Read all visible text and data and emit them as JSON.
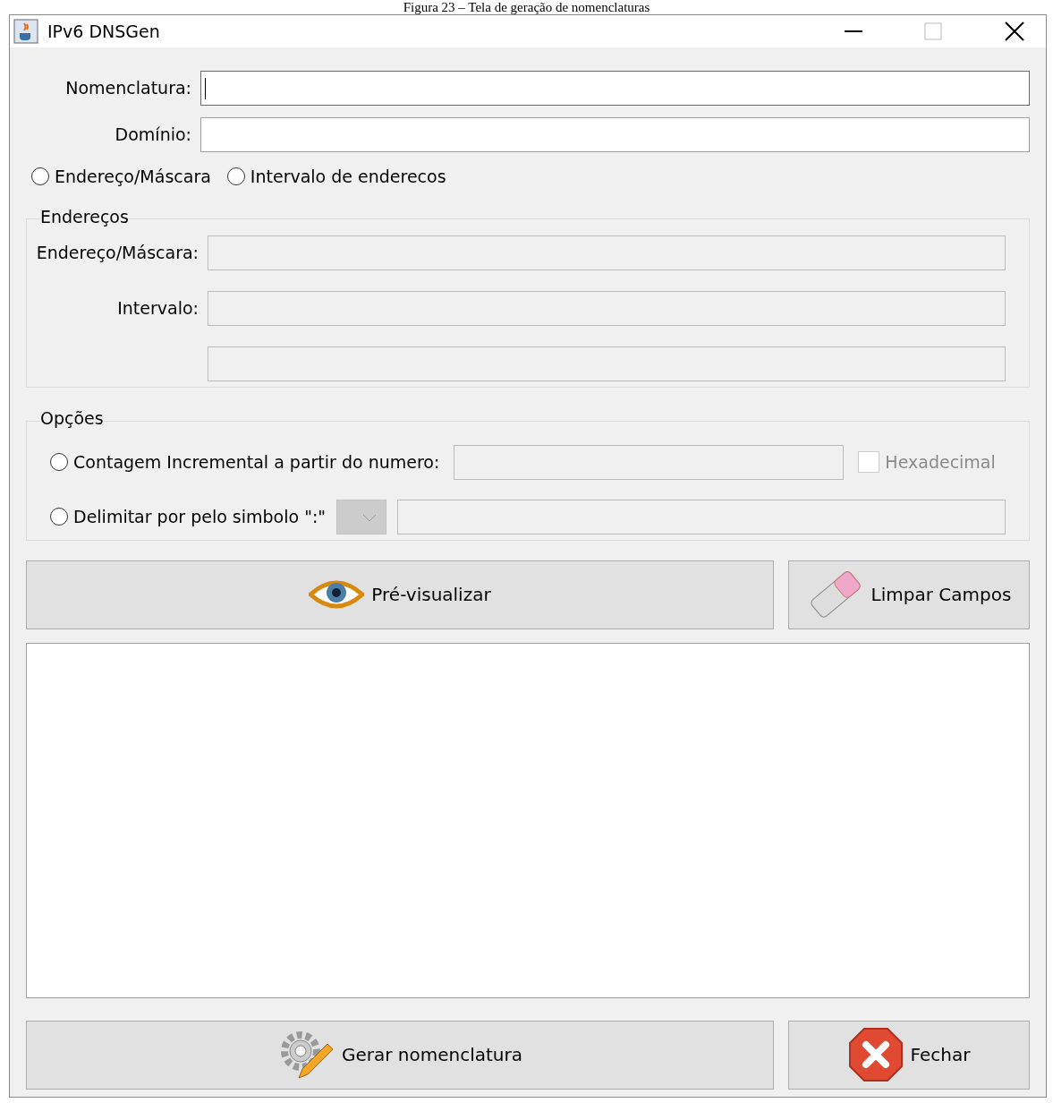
{
  "caption": "Figura 23 – Tela de geração de nomenclaturas",
  "window": {
    "title": "IPv6 DNSGen"
  },
  "fields": [
    {
      "label": "Nomenclatura:",
      "focused": true,
      "disabled": false
    },
    {
      "label": "Domínio:",
      "focused": false,
      "disabled": false
    }
  ],
  "mode_radios": [
    {
      "label": "Endereço/Máscara",
      "selected": false
    },
    {
      "label": "Intervalo de enderecos",
      "selected": false
    }
  ],
  "enderecos": {
    "title": "Endereços",
    "rows": [
      {
        "label": "Endereço/Máscara:",
        "disabled": true
      },
      {
        "label": "Intervalo:",
        "disabled": true
      },
      {
        "disabled": true
      }
    ]
  },
  "opcoes": {
    "title": "Opções",
    "incremental": {
      "label": "Contagem Incremental a partir do numero:",
      "selected": false,
      "field_disabled": true,
      "checkbox": {
        "label": "Hexadecimal",
        "checked": false,
        "disabled": true
      }
    },
    "delimitar": {
      "label": "Delimitar por pelo simbolo \":\"",
      "selected": false,
      "combo_disabled": true,
      "field_disabled": true
    }
  },
  "buttons": [
    {
      "kind": "preview",
      "label": "Pré-visualizar"
    },
    {
      "kind": "clear",
      "label": "Limpar Campos"
    }
  ],
  "bottom_buttons": [
    {
      "kind": "generate",
      "label": "Gerar nomenclatura"
    },
    {
      "kind": "close",
      "label": "Fechar"
    }
  ]
}
